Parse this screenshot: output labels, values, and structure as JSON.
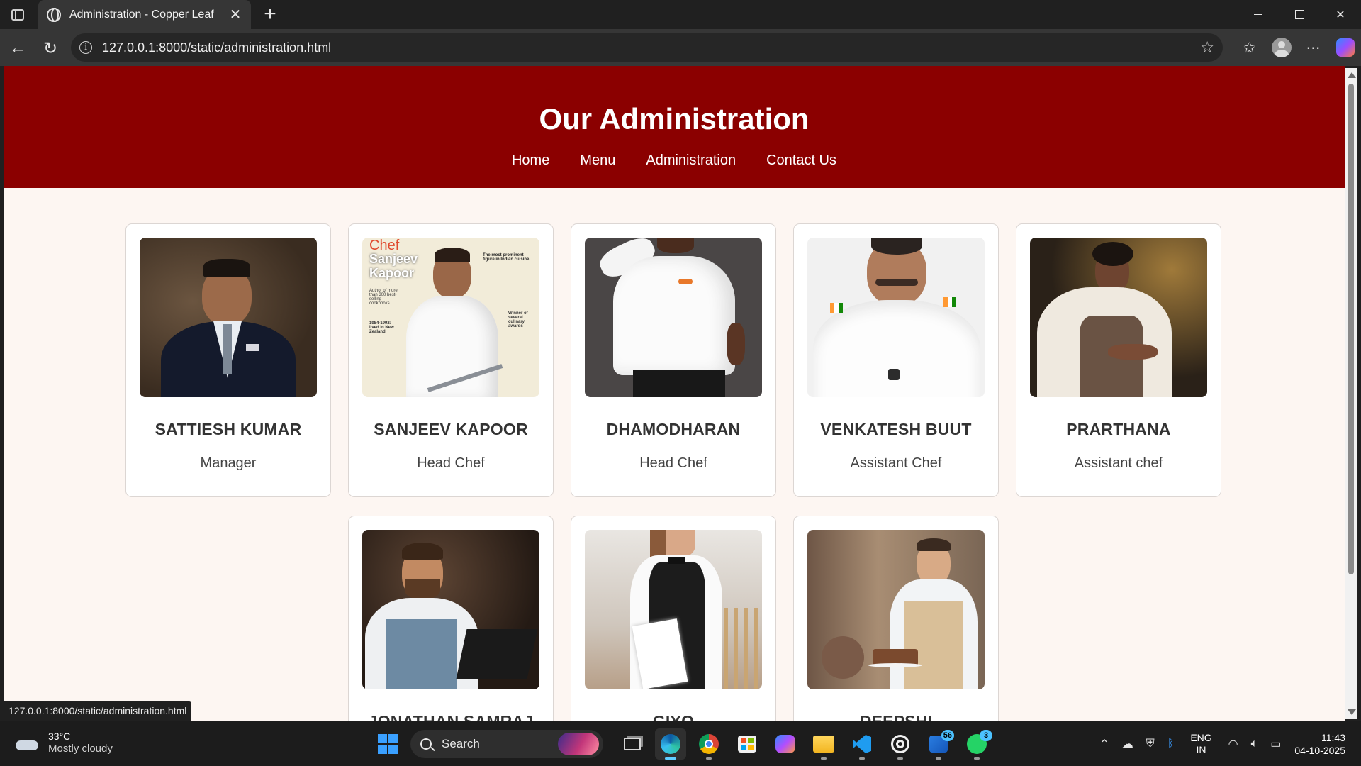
{
  "browser": {
    "tab_title": "Administration - Copper Leaf",
    "url": "127.0.0.1:8000/static/administration.html",
    "status_url": "127.0.0.1:8000/static/administration.html"
  },
  "page": {
    "title": "Our Administration",
    "nav": [
      "Home",
      "Menu",
      "Administration",
      "Contact Us"
    ],
    "staff": [
      {
        "name": "SATTIESH KUMAR",
        "role": "Manager"
      },
      {
        "name": "SANJEEV KAPOOR",
        "role": "Head Chef"
      },
      {
        "name": "DHAMODHARAN",
        "role": "Head Chef"
      },
      {
        "name": "VENKATESH BUUT",
        "role": "Assistant Chef"
      },
      {
        "name": "PRARTHANA",
        "role": "Assistant chef"
      },
      {
        "name": "JONATHAN SAMRAJ",
        "role": ""
      },
      {
        "name": "GIYO",
        "role": ""
      },
      {
        "name": "DEEPSHI",
        "role": ""
      }
    ],
    "poster_text": {
      "chef": "Chef",
      "name": "Sanjeev Kapoor",
      "blurb_1": "The most prominent figure in Indian cuisine",
      "blurb_2": "Author of more than 300 best-selling cookbooks",
      "blurb_3": "1984-1992: lived in New Zealand",
      "blurb_4": "Winner of several culinary awards"
    }
  },
  "taskbar": {
    "weather_temp": "33°C",
    "weather_condition": "Mostly cloudy",
    "search_label": "Search",
    "language_line1": "ENG",
    "language_line2": "IN",
    "time": "11:43",
    "date": "04-10-2025",
    "badges": {
      "todo": "56",
      "whatsapp": "3"
    }
  },
  "colors": {
    "header_red": "#8b0000",
    "page_background": "#fdf6f2",
    "card_border": "#dcd6d3"
  }
}
